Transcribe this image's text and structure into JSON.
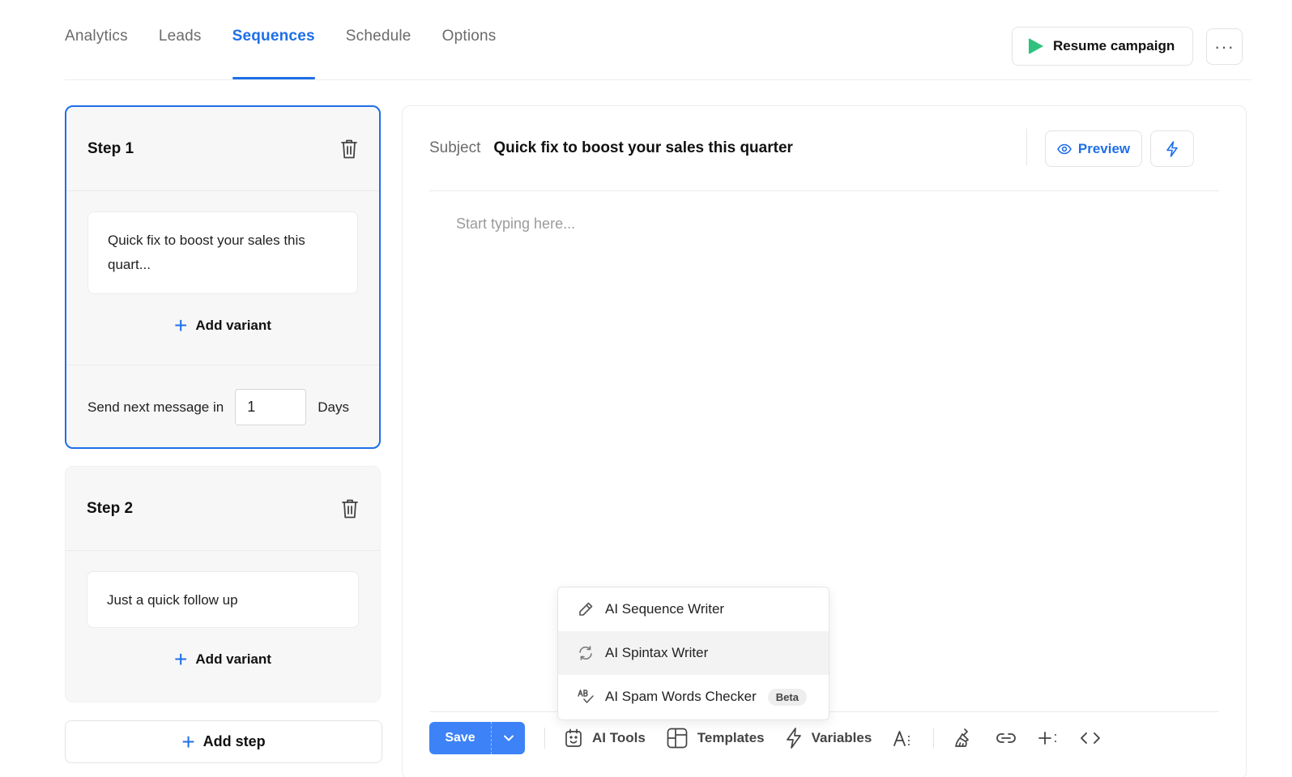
{
  "nav": {
    "tabs": [
      {
        "label": "Analytics"
      },
      {
        "label": "Leads"
      },
      {
        "label": "Sequences",
        "active": true
      },
      {
        "label": "Schedule"
      },
      {
        "label": "Options"
      }
    ],
    "resume_label": "Resume campaign",
    "more_label": "···"
  },
  "steps": [
    {
      "title": "Step 1",
      "variant_text": "Quick fix to boost your sales this quart...",
      "add_variant_label": "Add variant",
      "send_prefix": "Send next message in",
      "send_value": "1",
      "send_suffix": "Days"
    },
    {
      "title": "Step 2",
      "variant_text": "Just a quick follow up",
      "add_variant_label": "Add variant"
    }
  ],
  "add_step_label": "Add step",
  "editor": {
    "subject_label": "Subject",
    "subject_value": "Quick fix to boost your sales this quarter",
    "preview_label": "Preview",
    "body_placeholder": "Start typing here..."
  },
  "toolbar": {
    "save_label": "Save",
    "ai_tools_label": "AI Tools",
    "templates_label": "Templates",
    "variables_label": "Variables"
  },
  "ai_menu": {
    "items": [
      {
        "label": "AI Sequence Writer",
        "icon": "pencil-icon"
      },
      {
        "label": "AI Spintax Writer",
        "icon": "refresh-icon"
      },
      {
        "label": "AI Spam Words Checker",
        "icon": "spellcheck-icon",
        "badge": "Beta"
      }
    ]
  },
  "colors": {
    "accent": "#1e6fe8",
    "save": "#3d82f6",
    "play": "#2ec27e"
  }
}
